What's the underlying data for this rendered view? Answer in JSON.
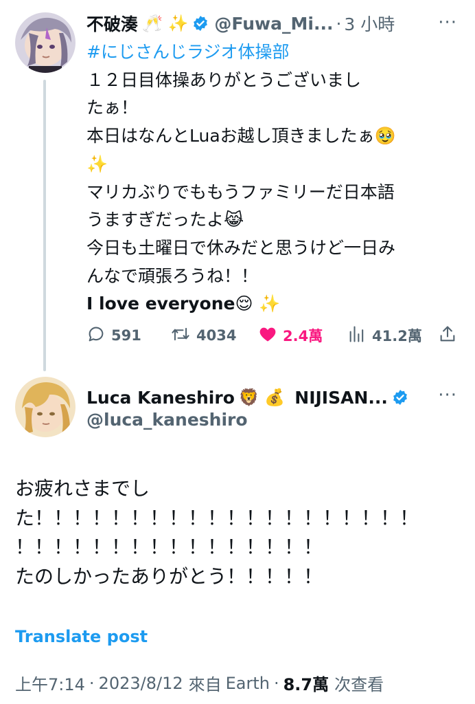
{
  "tweet1": {
    "author_name": "不破湊",
    "author_emojis": "🥂 ✨",
    "handle": "@Fuwa_Mi...",
    "time": "3 小時",
    "hashtag": "#にじさんじラジオ体操部",
    "lines": [
      "１２日目体操ありがとうございまし",
      "たぁ！",
      "本日はなんとLuaお越し頂きましたぁ🥹",
      "✨",
      "マリカぶりでももうファミリーだ日本語",
      "うますぎだったよ😹",
      "今日も土曜日で休みだと思うけど一日み",
      "んなで頑張ろうね！！",
      "I love everyone😌 ✨"
    ],
    "actions": {
      "replies": "591",
      "retweets": "4034",
      "likes": "2.4萬",
      "views": "41.2萬"
    },
    "more": "···"
  },
  "tweet2": {
    "author_name": "Luca Kaneshiro",
    "author_emojis": "🦁 💰",
    "author_suffix": "NIJISAN...",
    "handle": "@luca_kaneshiro",
    "more": "···",
    "lines": [
      "お疲れさまでし",
      "た！！！！！！！！！！！！！！！！！！！！",
      "！！！！！！！！！！！！！！！！",
      "たのしかったありがとう！！！！！"
    ],
    "translate": "Translate post",
    "meta": {
      "time": "上午7:14",
      "date": "2023/8/12",
      "source_prefix": "來自",
      "source": "Earth",
      "views": "8.7萬",
      "views_label": "次查看"
    }
  },
  "colors": {
    "link": "#1d9bf0",
    "like": "#f91880",
    "muted": "#536471",
    "verified": "#1d9bf0"
  },
  "icons": [
    "reply-icon",
    "retweet-icon",
    "heart-icon",
    "views-icon",
    "share-icon",
    "verified-badge-icon",
    "more-icon"
  ]
}
